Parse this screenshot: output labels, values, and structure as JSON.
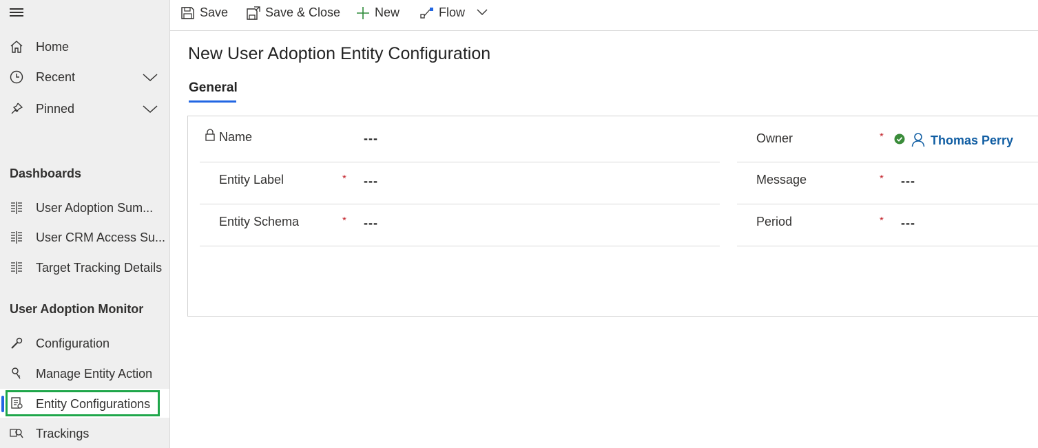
{
  "sidebar": {
    "menu_icon": "hamburger-icon",
    "top_items": [
      {
        "label": "Home",
        "icon": "home-icon"
      },
      {
        "label": "Recent",
        "icon": "clock-icon"
      },
      {
        "label": "Pinned",
        "icon": "pin-icon"
      }
    ],
    "dashboards_title": "Dashboards",
    "dashboards": [
      {
        "label": "User Adoption Sum...",
        "icon": "dashboard-icon"
      },
      {
        "label": "User CRM Access Su...",
        "icon": "dashboard-icon"
      },
      {
        "label": "Target Tracking Details",
        "icon": "dashboard-icon"
      }
    ],
    "monitor_title": "User Adoption Monitor",
    "monitor_items": [
      {
        "label": "Configuration",
        "icon": "wrench-icon"
      },
      {
        "label": "Manage Entity Action",
        "icon": "key-icon"
      },
      {
        "label": "Entity Configurations",
        "icon": "entity-config-icon",
        "selected": true
      },
      {
        "label": "Trackings",
        "icon": "tracking-icon"
      }
    ],
    "selection_accent": "#2266e3",
    "highlight_color": "#1fa64a"
  },
  "command_bar": {
    "save": "Save",
    "save_close": "Save & Close",
    "new": "New",
    "flow": "Flow"
  },
  "form": {
    "title": "New User Adoption Entity Configuration",
    "tabs": [
      {
        "label": "General",
        "active": true
      }
    ],
    "required_marker": "*",
    "left_fields": [
      {
        "label": "Name",
        "value": "---",
        "locked": true,
        "required": false
      },
      {
        "label": "Entity Label",
        "value": "---",
        "required": true
      },
      {
        "label": "Entity Schema",
        "value": "---",
        "required": true
      }
    ],
    "right_fields": [
      {
        "label": "Owner",
        "value": "Thomas Perry",
        "required": true,
        "type": "lookup"
      },
      {
        "label": "Message",
        "value": "---",
        "required": true
      },
      {
        "label": "Period",
        "value": "---",
        "required": true
      }
    ],
    "link_color": "#115ea3",
    "required_color": "#c4262e",
    "presence_color": "#3a8c3a"
  }
}
